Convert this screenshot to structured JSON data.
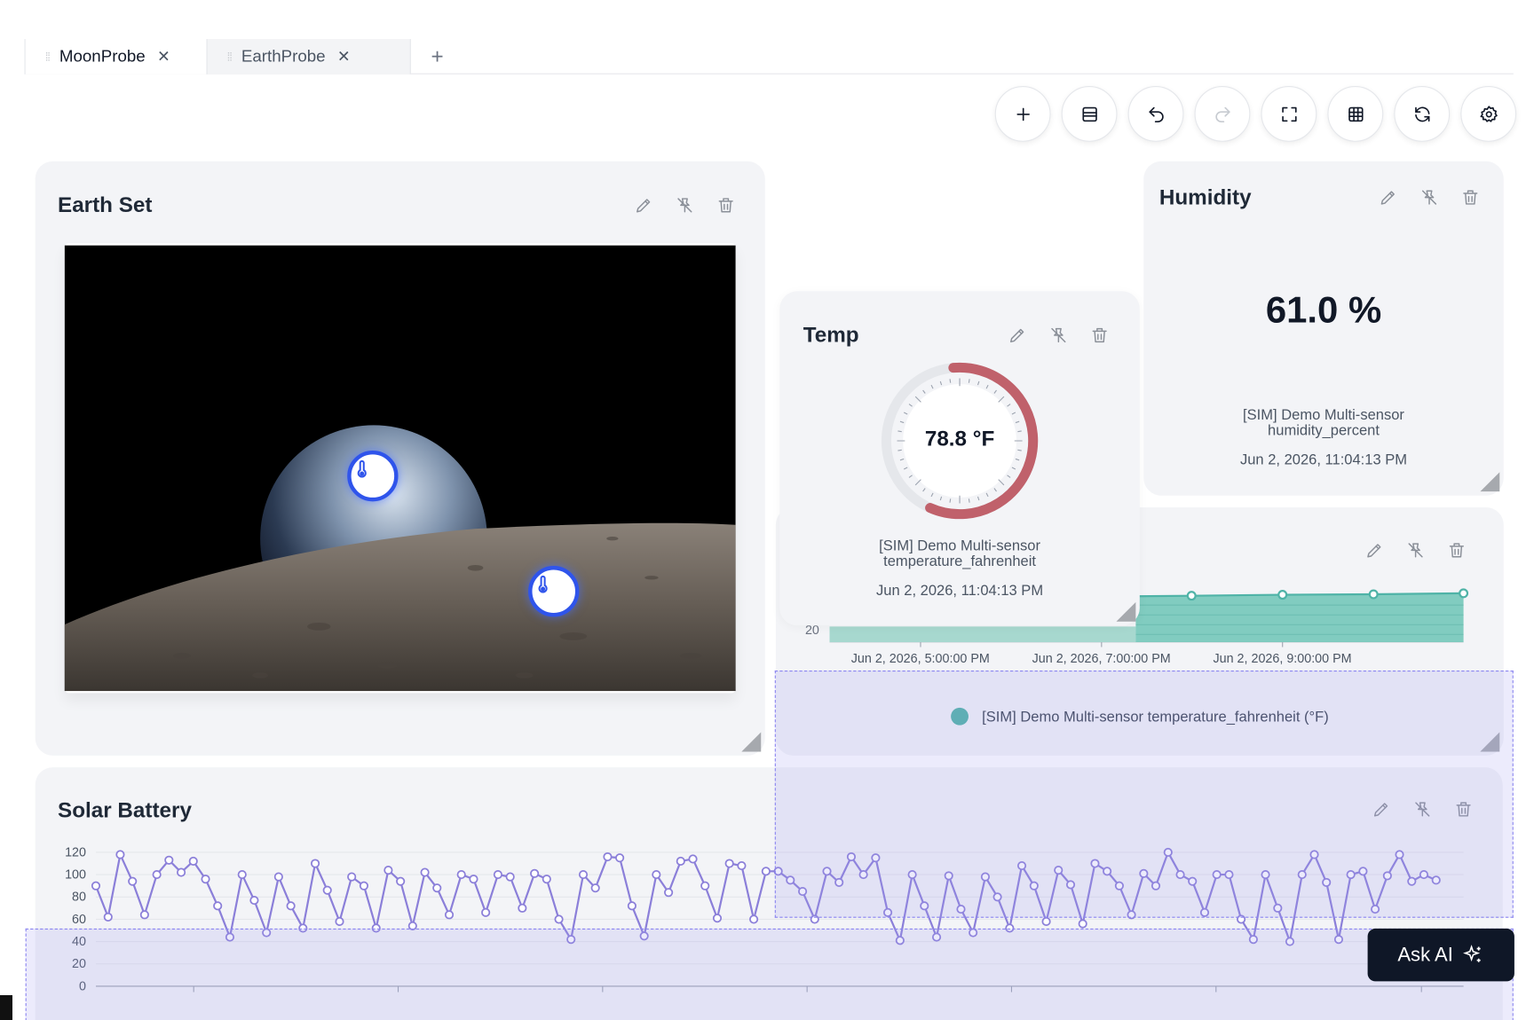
{
  "tabs": [
    {
      "label": "MoonProbe",
      "active": true
    },
    {
      "label": "EarthProbe",
      "active": false
    }
  ],
  "toolbar": {
    "buttons": [
      {
        "icon": "plus-icon"
      },
      {
        "icon": "layout-icon"
      },
      {
        "icon": "undo-icon"
      },
      {
        "icon": "redo-icon",
        "disabled": true
      },
      {
        "icon": "fullscreen-icon"
      },
      {
        "icon": "grid-icon"
      },
      {
        "icon": "refresh-icon"
      },
      {
        "icon": "settings-icon"
      }
    ]
  },
  "widgets": {
    "earth_set": {
      "title": "Earth Set"
    },
    "humidity": {
      "title": "Humidity",
      "value": "61.0 %",
      "source": "[SIM] Demo Multi-sensor",
      "metric": "humidity_percent",
      "timestamp": "Jun 2, 2026, 11:04:13 PM"
    },
    "temp": {
      "title": "Temp",
      "value": "78.8 °F",
      "gauge_fraction": 0.58,
      "source": "[SIM] Demo Multi-sensor",
      "metric": "temperature_fahrenheit",
      "timestamp": "Jun 2, 2026, 11:04:13 PM"
    },
    "temp_chart": {
      "legend": "[SIM] Demo Multi-sensor temperature_fahrenheit (°F)",
      "y_tick_visible": "20",
      "x_ticks": [
        "Jun 2, 2026, 5:00:00 PM",
        "Jun 2, 2026, 7:00:00 PM",
        "Jun 2, 2026, 9:00:00 PM"
      ]
    },
    "solar_battery": {
      "title": "Solar Battery",
      "y_ticks": [
        "120",
        "100",
        "80",
        "60",
        "40",
        "20",
        "0"
      ]
    }
  },
  "colors": {
    "accent": "#8b7fd9",
    "teal": "#4fb3a7",
    "gauge": "#c0616b"
  },
  "ask_ai": {
    "label": "Ask AI"
  },
  "chart_data": [
    {
      "type": "area",
      "series": [
        {
          "name": "[SIM] Demo Multi-sensor temperature_fahrenheit (°F)",
          "values": [
            78.2,
            78.3,
            78.5,
            78.6,
            78.8
          ]
        }
      ],
      "x": [
        "Jun 2, 2026, 7:15:00 PM",
        "Jun 2, 2026, 8:00:00 PM",
        "Jun 2, 2026, 9:00:00 PM",
        "Jun 2, 2026, 10:00:00 PM",
        "Jun 2, 2026, 11:00:00 PM"
      ],
      "xlabel": "",
      "ylabel": ""
    },
    {
      "type": "line",
      "series": [
        {
          "name": "",
          "values": [
            90,
            62,
            118,
            94,
            64,
            100,
            113,
            102,
            112,
            96,
            72,
            44,
            100,
            77,
            48,
            98,
            72,
            52,
            110,
            86,
            58,
            98,
            90,
            52,
            104,
            94,
            54,
            102,
            88,
            64,
            100,
            96,
            66,
            100,
            98,
            70,
            101,
            96,
            60,
            42,
            100,
            88,
            116,
            115,
            72,
            45,
            100,
            84,
            112,
            114,
            90,
            61,
            110,
            108,
            60,
            103,
            103,
            95,
            85,
            60,
            103,
            93,
            116,
            100,
            115,
            66,
            41,
            100,
            72,
            44,
            99,
            69,
            48,
            98,
            80,
            52,
            108,
            90,
            58,
            104,
            91,
            56,
            110,
            103,
            90,
            64,
            101,
            90,
            120,
            100,
            94,
            66,
            100,
            100,
            60,
            42,
            100,
            70,
            40,
            100,
            118,
            93,
            42,
            100,
            103,
            69,
            99,
            118,
            94,
            100,
            95
          ]
        }
      ],
      "ylim": [
        0,
        120
      ],
      "xlabel": "",
      "ylabel": ""
    }
  ]
}
